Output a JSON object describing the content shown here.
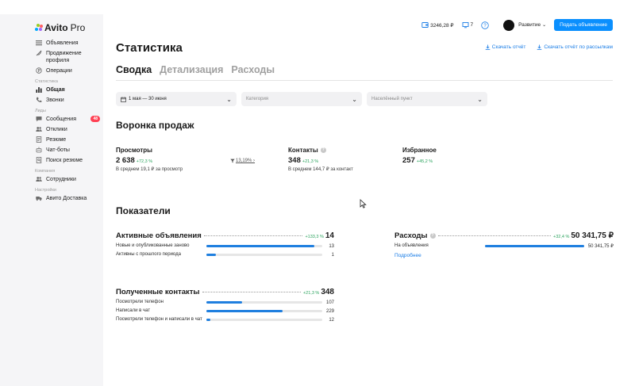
{
  "brand": {
    "name": "Avito",
    "suffix": "Pro",
    "dot_colors": [
      "#00aaff",
      "#97cf26",
      "#ff6163",
      "#a169f7"
    ]
  },
  "sidebar": {
    "items_top": [
      {
        "label": "Объявления",
        "icon": "list-icon"
      },
      {
        "label": "Продвижение профиля",
        "icon": "rocket-icon"
      },
      {
        "label": "Операции",
        "icon": "ruble-circle-icon"
      }
    ],
    "group_stats": "Статистика",
    "items_stats": [
      {
        "label": "Общая",
        "icon": "bar-chart-icon",
        "active": true
      },
      {
        "label": "Звонки",
        "icon": "phone-icon"
      }
    ],
    "group_leads": "Лиды",
    "items_leads": [
      {
        "label": "Сообщения",
        "icon": "chat-icon",
        "badge": "48"
      },
      {
        "label": "Отклики",
        "icon": "users-icon"
      },
      {
        "label": "Резюме",
        "icon": "document-icon"
      },
      {
        "label": "Чат-боты",
        "icon": "bot-icon"
      },
      {
        "label": "Поиск резюме",
        "icon": "document-search-icon"
      }
    ],
    "group_company": "Компания",
    "items_company": [
      {
        "label": "Сотрудники",
        "icon": "users-icon"
      }
    ],
    "group_settings": "Настройки",
    "items_settings": [
      {
        "label": "Авито Доставка",
        "icon": "truck-icon"
      }
    ]
  },
  "header": {
    "wallet": "3246,28 ₽",
    "bonus": "7",
    "help_icon": "help-icon",
    "account": "Развитие",
    "cta": "Подать объявление"
  },
  "page": {
    "title": "Статистика",
    "download": "Скачать отчёт",
    "download_mail": "Скачать отчёт по рассылкам",
    "tabs": [
      "Сводка",
      "Детализация",
      "Расходы"
    ]
  },
  "filters": {
    "dates": "1 мая — 30 июня",
    "category_placeholder": "Категория",
    "city_placeholder": "Населённый пункт"
  },
  "funnel": {
    "title": "Воронка продаж",
    "views": {
      "label": "Просмотры",
      "value": "2 638",
      "delta": "+72,3 %",
      "sub": "В среднем 19,1 ₽ за просмотр"
    },
    "conversion": "13,19% ›",
    "contacts": {
      "label": "Контакты",
      "value": "348",
      "delta": "+21,3 %",
      "sub": "В среднем 144,7 ₽ за контакт"
    },
    "favorites": {
      "label": "Избранное",
      "value": "257",
      "delta": "+45,2 %"
    }
  },
  "indicators": {
    "title": "Показатели",
    "active": {
      "title": "Активные объявления",
      "delta": "+133,3 %",
      "value": "14",
      "rows": [
        {
          "label": "Новые и опубликованные заново",
          "value": "13",
          "fraction": 0.93
        },
        {
          "label": "Активны с прошлого периода",
          "value": "1",
          "fraction": 0.08
        }
      ]
    },
    "expenses": {
      "title": "Расходы",
      "delta": "+32,4 %",
      "value": "50 341,75 ₽",
      "rows": [
        {
          "label": "На объявления",
          "value": "50 341,75 ₽",
          "fraction": 1.0
        }
      ],
      "more": "Подробнее"
    },
    "contacts": {
      "title": "Полученные контакты",
      "delta": "+21,3 %",
      "value": "348",
      "rows": [
        {
          "label": "Посмотрели телефон",
          "value": "107",
          "fraction": 0.31
        },
        {
          "label": "Написали в чат",
          "value": "229",
          "fraction": 0.66
        },
        {
          "label": "Посмотрели телефон и написали в чат",
          "value": "12",
          "fraction": 0.035
        }
      ]
    }
  }
}
